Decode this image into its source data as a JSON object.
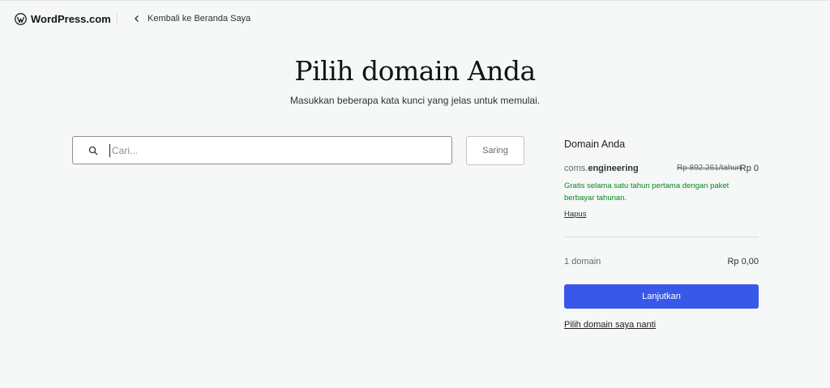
{
  "header": {
    "logo_text": "WordPress.com",
    "back_label": "Kembali ke Beranda Saya"
  },
  "main": {
    "title": "Pilih domain Anda",
    "subtitle": "Masukkan beberapa kata kunci yang jelas untuk memulai.",
    "search": {
      "placeholder": "Cari...",
      "value": ""
    },
    "filter_label": "Saring"
  },
  "cart": {
    "title": "Domain Anda",
    "domain": {
      "prefix": "coms.",
      "tld": "engineering"
    },
    "price_original": "Rp 892.261/tahun",
    "price_current": "Rp 0",
    "promo_text": "Gratis selama satu tahun pertama dengan paket berbayar tahunan.",
    "remove_label": "Hapus",
    "count_label": "1 domain",
    "total": "Rp 0,00",
    "continue_label": "Lanjutkan",
    "later_label": "Pilih domain saya nanti"
  },
  "colors": {
    "accent": "#3858e9",
    "promo": "#008a20",
    "background": "#f6f7f7"
  },
  "icons": [
    "wordpress-logo-icon",
    "chevron-left-icon",
    "search-icon"
  ]
}
